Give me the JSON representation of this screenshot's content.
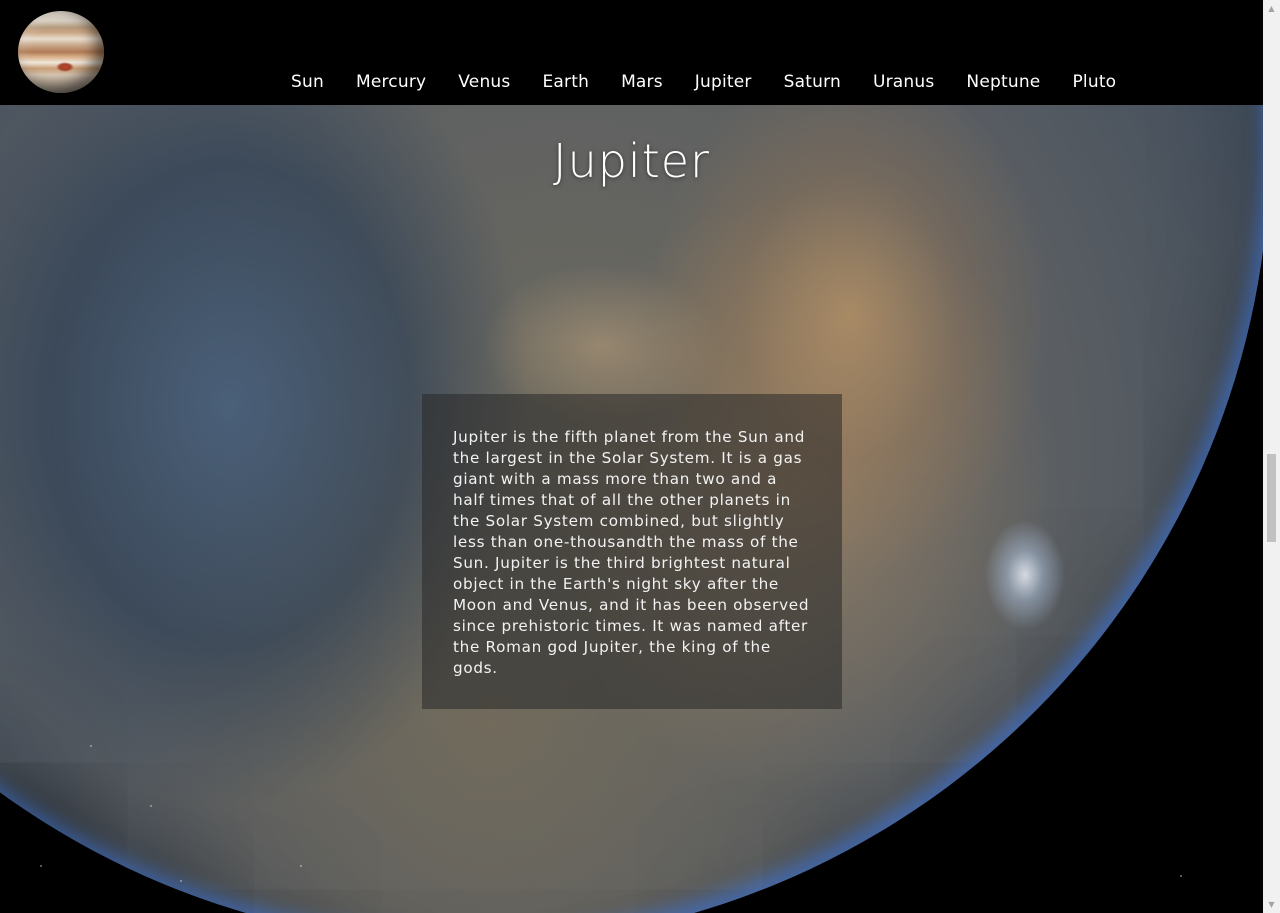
{
  "header": {
    "logo_icon": "jupiter-planet-logo",
    "nav": [
      {
        "label": "Sun"
      },
      {
        "label": "Mercury"
      },
      {
        "label": "Venus"
      },
      {
        "label": "Earth"
      },
      {
        "label": "Mars"
      },
      {
        "label": "Jupiter"
      },
      {
        "label": "Saturn"
      },
      {
        "label": "Uranus"
      },
      {
        "label": "Neptune"
      },
      {
        "label": "Pluto"
      }
    ]
  },
  "main": {
    "title": "Jupiter",
    "description": "Jupiter is the fifth planet from the Sun and the largest in the Solar System. It is a gas giant with a mass more than two and a half times that of all the other planets in the Solar System combined, but slightly less than one-thousandth the mass of the Sun. Jupiter is the third brightest natural object in the Earth's night sky after the Moon and Venus, and it has been observed since prehistoric times. It was named after the Roman god Jupiter, the king of the gods."
  },
  "colors": {
    "header_bg": "#000000",
    "text": "#ffffff",
    "info_box_bg": "rgba(40,40,40,0.55)"
  }
}
